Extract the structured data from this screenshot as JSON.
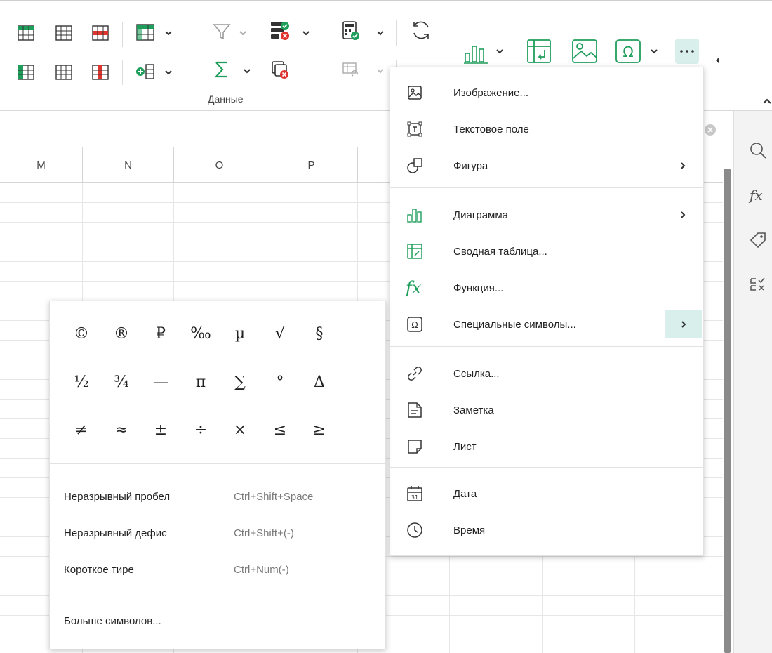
{
  "ribbon": {
    "data_group_label": "Данные"
  },
  "columns": [
    "M",
    "N",
    "O",
    "P"
  ],
  "insert_menu": {
    "items": [
      {
        "label": "Изображение...",
        "icon": "image-icon"
      },
      {
        "label": "Текстовое поле",
        "icon": "text-box-icon"
      },
      {
        "label": "Фигура",
        "icon": "shape-icon",
        "submenu": true
      },
      {
        "label": "Диаграмма",
        "icon": "chart-icon",
        "submenu": true
      },
      {
        "label": "Сводная таблица...",
        "icon": "pivot-table-icon"
      },
      {
        "label": "Функция...",
        "icon": "function-icon"
      },
      {
        "label": "Специальные символы...",
        "icon": "omega-icon",
        "submenu": true,
        "active": true
      },
      {
        "label": "Ссылка...",
        "icon": "link-icon"
      },
      {
        "label": "Заметка",
        "icon": "note-icon"
      },
      {
        "label": "Лист",
        "icon": "sheet-icon"
      },
      {
        "label": "Дата",
        "icon": "calendar-icon"
      },
      {
        "label": "Время",
        "icon": "clock-icon"
      }
    ],
    "date_icon_text": "31"
  },
  "special_symbols": {
    "symbols": [
      [
        "©",
        "®",
        "₽",
        "‰",
        "µ",
        "√",
        "§"
      ],
      [
        "½",
        "¾",
        "—",
        "π",
        "∑",
        "°",
        "Δ"
      ],
      [
        "≠",
        "≈",
        "±",
        "÷",
        "×",
        "≤",
        "≥"
      ]
    ],
    "shortcuts": [
      {
        "label": "Неразрывный пробел",
        "keys": "Ctrl+Shift+Space"
      },
      {
        "label": "Неразрывный дефис",
        "keys": "Ctrl+Shift+(-)"
      },
      {
        "label": "Короткое тире",
        "keys": "Ctrl+Num(-)"
      }
    ],
    "more_label": "Больше символов..."
  },
  "colors": {
    "accent_green": "#1f9e5b",
    "accent_teal": "#3aa9a0",
    "active_bg": "#d8efec",
    "red": "#e0342f"
  }
}
